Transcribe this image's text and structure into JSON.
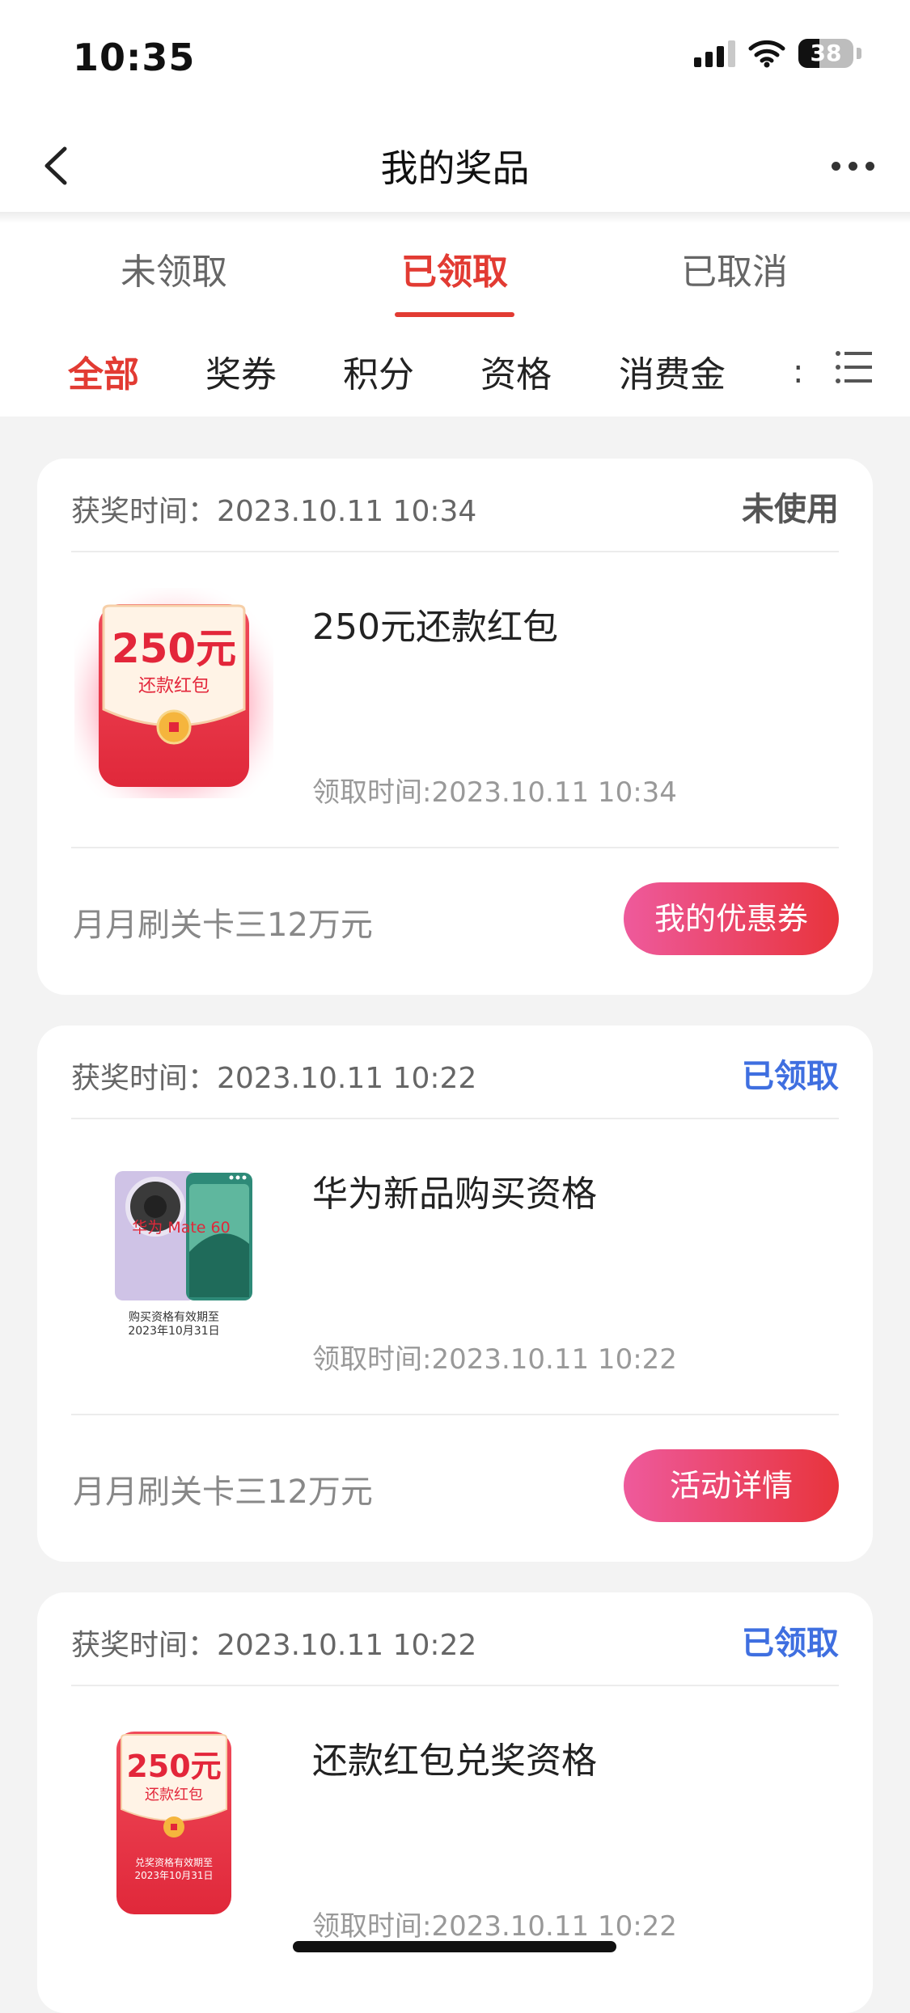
{
  "status_bar": {
    "time": "10:35",
    "battery": "38",
    "battery_level": 0.38
  },
  "nav": {
    "title": "我的奖品"
  },
  "status_tabs": [
    {
      "label": "未领取",
      "active": false
    },
    {
      "label": "已领取",
      "active": true
    },
    {
      "label": "已取消",
      "active": false
    }
  ],
  "category_tabs": [
    {
      "label": "全部",
      "active": true
    },
    {
      "label": "奖券",
      "active": false
    },
    {
      "label": "积分",
      "active": false
    },
    {
      "label": "资格",
      "active": false
    },
    {
      "label": "消费金",
      "active": false
    }
  ],
  "category_overflow": ":",
  "colors": {
    "accent": "#e23b33",
    "claimed": "#3f6fe0",
    "button_start": "#ee5a9c",
    "button_end": "#e8343c"
  },
  "cards": [
    {
      "award_time": "获奖时间：2023.10.11 10:34",
      "state": "未使用",
      "prize_name": "250元还款红包",
      "receive_time": "领取时间:2023.10.11 10:34",
      "activity": "月月刷关卡三12万元",
      "button": "我的优惠券",
      "image": {
        "amount": "250元",
        "caption": "还款红包"
      }
    },
    {
      "award_time": "获奖时间：2023.10.11 10:22",
      "state": "已领取",
      "prize_name": "华为新品购买资格",
      "receive_time": "领取时间:2023.10.11 10:22",
      "activity": "月月刷关卡三12万元",
      "button": "活动详情",
      "image": {
        "label": "华为 Mate 60",
        "caption1": "购买资格有效期至",
        "caption2": "2023年10月31日"
      }
    },
    {
      "award_time": "获奖时间：2023.10.11 10:22",
      "state": "已领取",
      "prize_name": "还款红包兑奖资格",
      "receive_time": "领取时间:2023.10.11 10:22",
      "image": {
        "amount": "250元",
        "caption": "还款红包",
        "caption1": "兑奖资格有效期至",
        "caption2": "2023年10月31日"
      }
    }
  ]
}
